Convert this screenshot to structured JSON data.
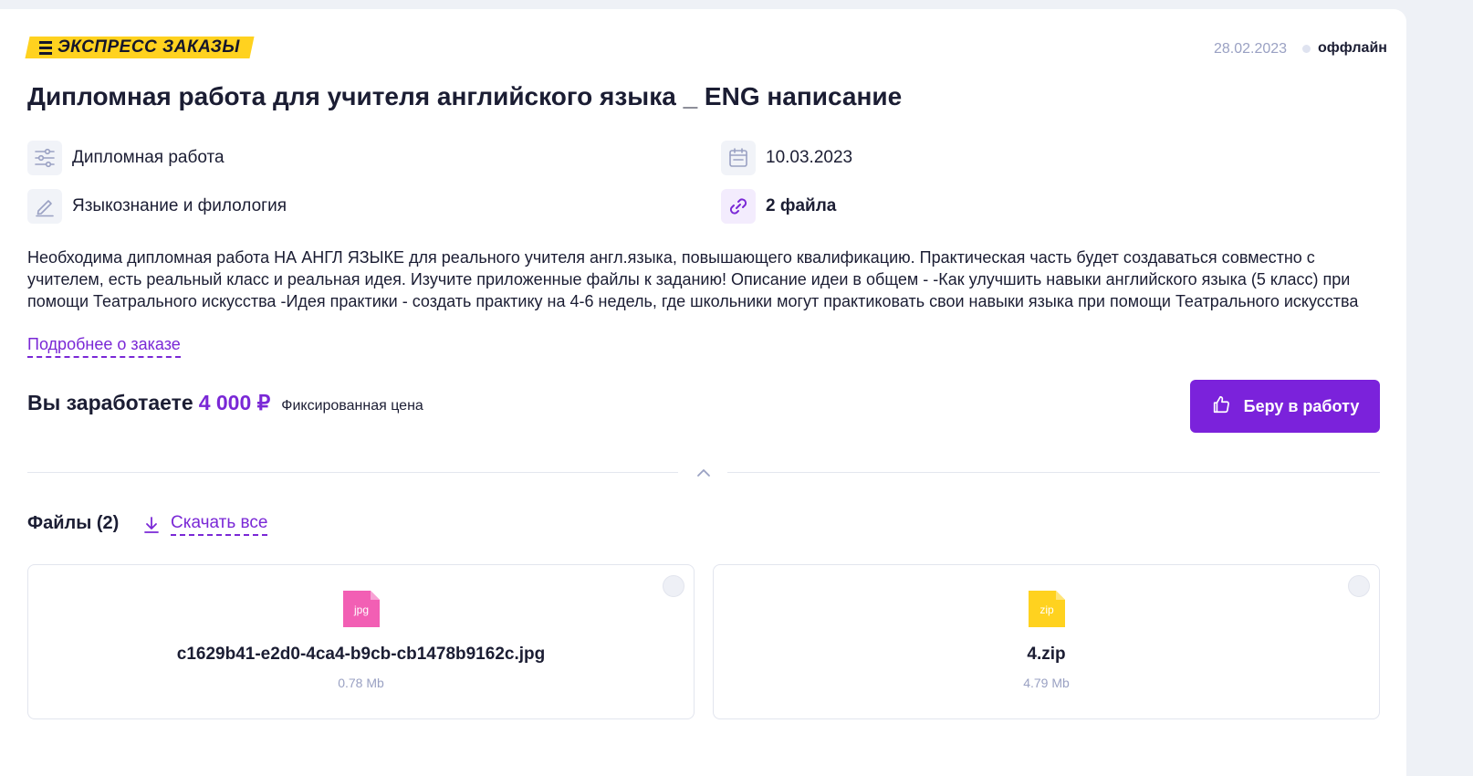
{
  "header": {
    "badge_label": "ЭКСПРЕСС ЗАКАЗЫ",
    "date": "28.02.2023",
    "status_label": "оффлайн"
  },
  "order": {
    "title": "Дипломная работа для учителя английского языка _ ENG написание",
    "work_type": "Дипломная работа",
    "subject": "Языкознание и филология",
    "deadline": "10.03.2023",
    "attachments_label": "2 файла",
    "description": "Необходима дипломная работа НА АНГЛ ЯЗЫКЕ для реального учителя англ.языка, повышающего квалификацию. Практическая часть будет создаваться совместно с учителем, есть реальный класс и реальная идея. Изучите приложенные файлы к заданию! Описание идеи в общем - -Как улучшить навыки английского языка (5 класс) при помощи Театрального искусства -Идея практики - создать практику на 4-6 недель, где школьники могут практиковать свои навыки языка при помощи Театрального искусства",
    "more_link": "Подробнее о заказе"
  },
  "earnings": {
    "label": "Вы заработаете",
    "amount": "4 000 ₽",
    "note": "Фиксированная цена"
  },
  "take_button": {
    "label": "Беру в работу"
  },
  "files": {
    "title": "Файлы (2)",
    "download_all": "Скачать все",
    "items": [
      {
        "ext": "jpg",
        "name": "c1629b41-e2d0-4ca4-b9cb-cb1478b9162c.jpg",
        "size": "0.78 Mb",
        "color": "#f25fb4"
      },
      {
        "ext": "zip",
        "name": "4.zip",
        "size": "4.79 Mb",
        "color": "#ffd21f"
      }
    ]
  },
  "colors": {
    "accent": "#7b22db",
    "badge": "#ffd21f"
  }
}
